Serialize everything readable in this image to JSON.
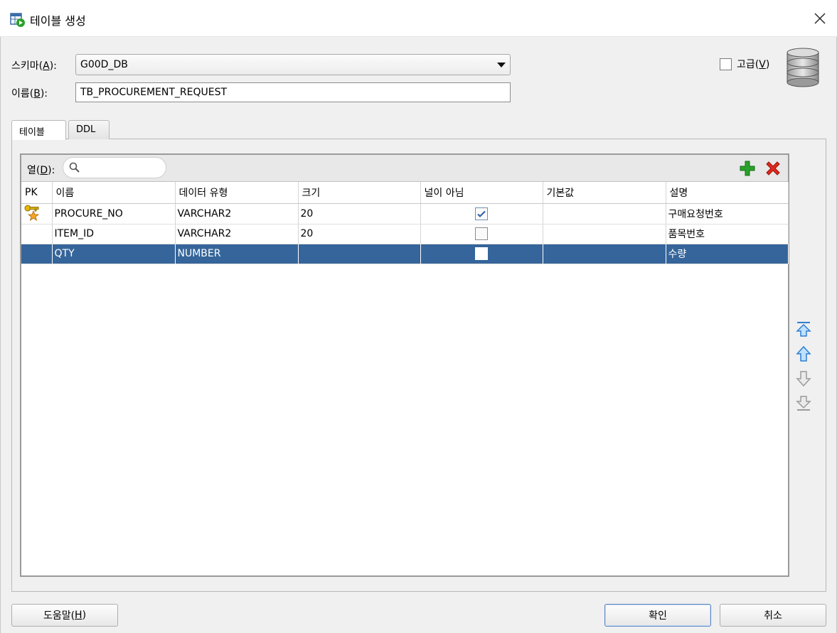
{
  "window": {
    "title": "테이블 생성"
  },
  "schema": {
    "label_prefix": "스키마(",
    "label_key": "A",
    "label_suffix": "):",
    "value": "G00D_DB"
  },
  "name": {
    "label_prefix": "이름(",
    "label_key": "B",
    "label_suffix": "):",
    "value": "TB_PROCUREMENT_REQUEST"
  },
  "advanced": {
    "label_prefix": "고급(",
    "label_key": "V",
    "label_suffix": ")",
    "checked": false
  },
  "tabs": [
    {
      "label": "테이블",
      "active": true
    },
    {
      "label": "DDL",
      "active": false
    }
  ],
  "columns_panel": {
    "label_prefix": "열(",
    "label_key": "D",
    "label_suffix": "):",
    "search_placeholder": ""
  },
  "table": {
    "headers": [
      "PK",
      "이름",
      "데이터 유형",
      "크기",
      "널이 아님",
      "기본값",
      "설명"
    ],
    "rows": [
      {
        "pk": true,
        "name": "PROCURE_NO",
        "type": "VARCHAR2",
        "size": "20",
        "not_null": true,
        "default": "",
        "desc": "구매요청번호"
      },
      {
        "pk": false,
        "name": "ITEM_ID",
        "type": "VARCHAR2",
        "size": "20",
        "not_null": false,
        "default": "",
        "desc": "품목번호"
      },
      {
        "pk": false,
        "name": "QTY",
        "type": "NUMBER",
        "size": "",
        "not_null": false,
        "default": "",
        "desc": "수량",
        "selected": true
      }
    ]
  },
  "buttons": {
    "help_prefix": "도움말(",
    "help_key": "H",
    "help_suffix": ")",
    "ok": "확인",
    "cancel": "취소"
  },
  "colors": {
    "selection": "#35659a",
    "add": "#2aa12a",
    "delete": "#e02a1e",
    "move": "#2f7fd0"
  }
}
